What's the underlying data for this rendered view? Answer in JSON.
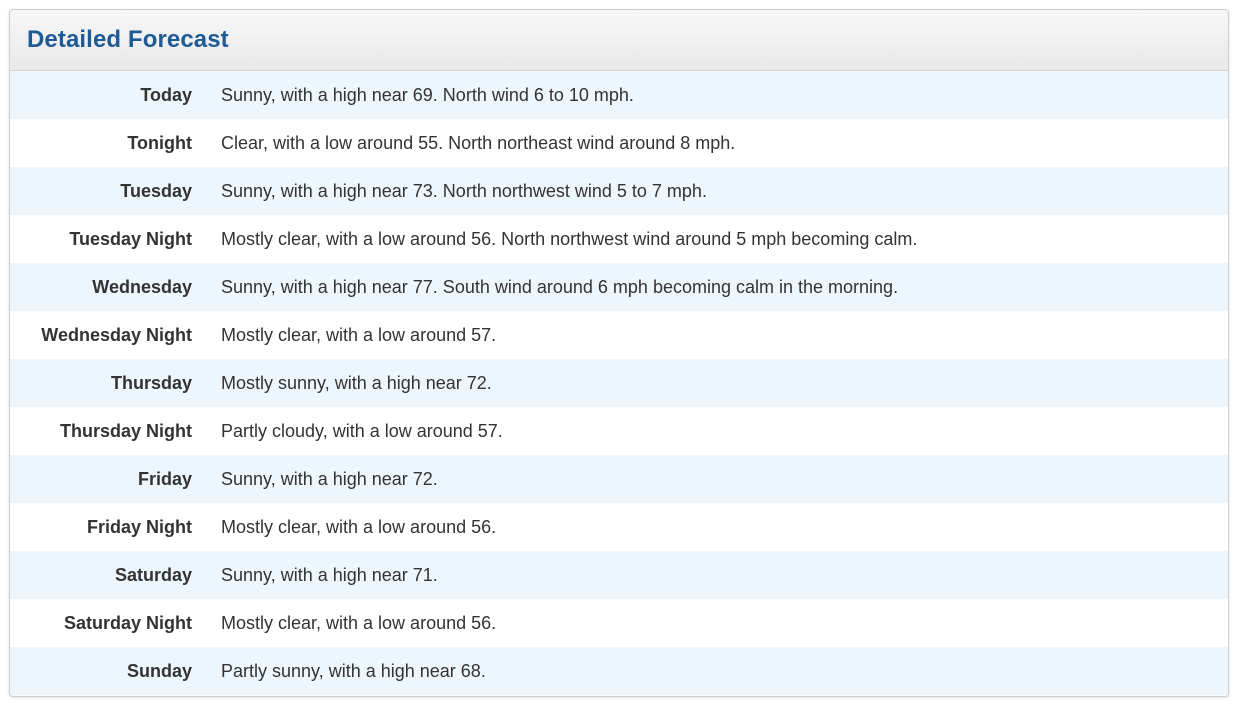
{
  "panel": {
    "title": "Detailed Forecast",
    "title_color": "#1e5a94",
    "row_alt_color": "#eef6fd"
  },
  "forecast": [
    {
      "period": "Today",
      "text": "Sunny, with a high near 69. North wind 6 to 10 mph."
    },
    {
      "period": "Tonight",
      "text": "Clear, with a low around 55. North northeast wind around 8 mph."
    },
    {
      "period": "Tuesday",
      "text": "Sunny, with a high near 73. North northwest wind 5 to 7 mph."
    },
    {
      "period": "Tuesday Night",
      "text": "Mostly clear, with a low around 56. North northwest wind around 5 mph becoming calm."
    },
    {
      "period": "Wednesday",
      "text": "Sunny, with a high near 77. South wind around 6 mph becoming calm in the morning."
    },
    {
      "period": "Wednesday Night",
      "text": "Mostly clear, with a low around 57."
    },
    {
      "period": "Thursday",
      "text": "Mostly sunny, with a high near 72."
    },
    {
      "period": "Thursday Night",
      "text": "Partly cloudy, with a low around 57."
    },
    {
      "period": "Friday",
      "text": "Sunny, with a high near 72."
    },
    {
      "period": "Friday Night",
      "text": "Mostly clear, with a low around 56."
    },
    {
      "period": "Saturday",
      "text": "Sunny, with a high near 71."
    },
    {
      "period": "Saturday Night",
      "text": "Mostly clear, with a low around 56."
    },
    {
      "period": "Sunday",
      "text": "Partly sunny, with a high near 68."
    }
  ]
}
